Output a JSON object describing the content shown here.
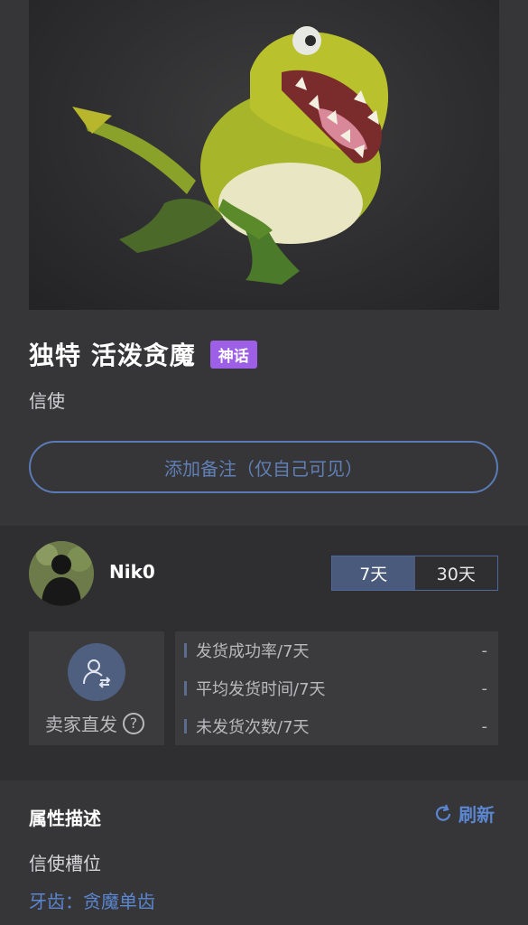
{
  "item": {
    "title": "独特 活泼贪魔",
    "rarity_badge": "神话",
    "rarity_color": "#9d5fe6",
    "type": "信使"
  },
  "note_button": {
    "label": "添加备注（仅自己可见）"
  },
  "seller": {
    "name": "Nik0",
    "period_tabs": [
      {
        "label": "7天",
        "active": true
      },
      {
        "label": "30天",
        "active": false
      }
    ],
    "direct_shipping": {
      "label": "卖家直发",
      "help_icon": "question-circle-icon"
    },
    "stats": [
      {
        "label": "发货成功率/7天",
        "value": "-"
      },
      {
        "label": "平均发货时间/7天",
        "value": "-"
      },
      {
        "label": "未发货次数/7天",
        "value": "-"
      }
    ]
  },
  "attributes": {
    "title": "属性描述",
    "refresh_label": "刷新",
    "lines": [
      {
        "text": "信使槽位"
      },
      {
        "text": "牙齿：贪魔单齿"
      }
    ]
  },
  "colors": {
    "accent_blue": "#5b86d1",
    "segment_active": "#4a5a7c"
  }
}
